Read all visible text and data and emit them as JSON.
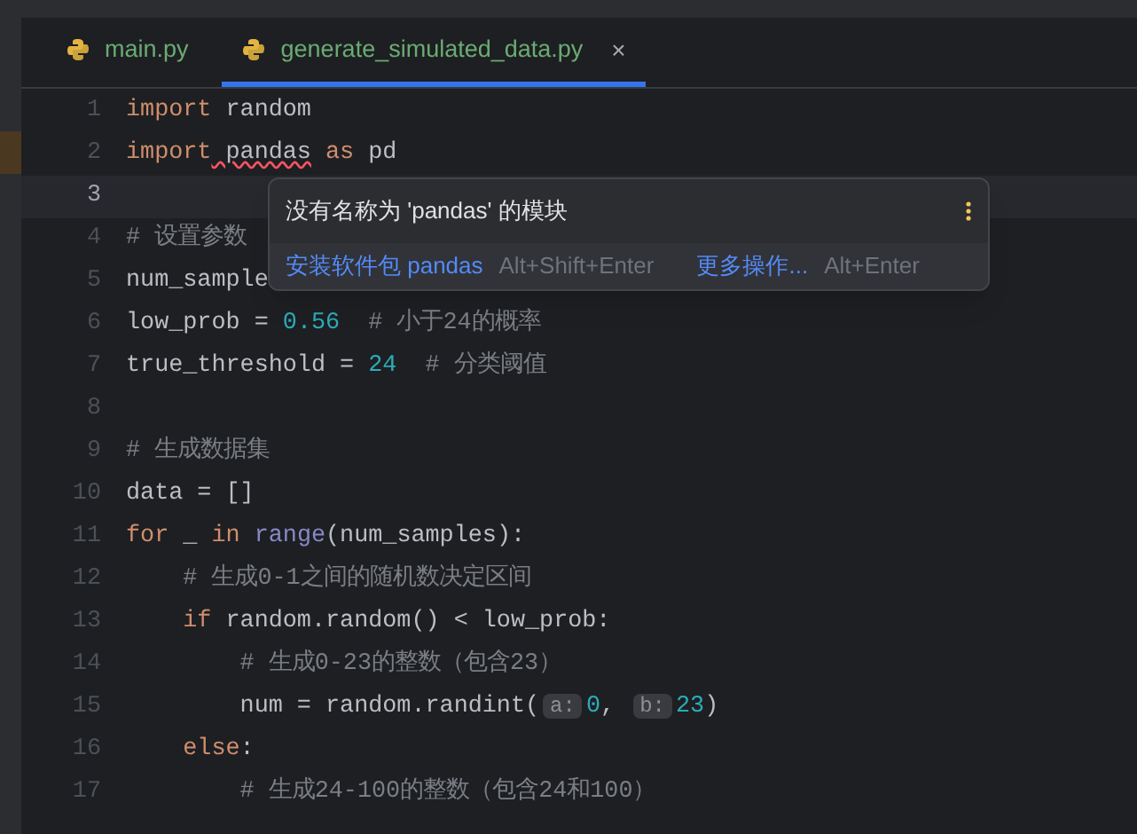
{
  "tabs": [
    {
      "label": "main.py",
      "selected": false
    },
    {
      "label": "generate_simulated_data.py",
      "selected": true,
      "close": "×"
    }
  ],
  "editor": {
    "lines": [
      {
        "number": "1",
        "current": false,
        "tokens": [
          {
            "kind": "keyword",
            "text": "import"
          },
          {
            "kind": "plain",
            "text": " random"
          }
        ]
      },
      {
        "number": "2",
        "current": false,
        "marked": true,
        "tokens": [
          {
            "kind": "keyword",
            "text": "import"
          },
          {
            "kind": "error",
            "text": " pandas"
          },
          {
            "kind": "keyword",
            "text": " as"
          },
          {
            "kind": "plain",
            "text": " pd"
          }
        ]
      },
      {
        "number": "3",
        "current": true
      },
      {
        "number": "4",
        "current": false,
        "tokens": [
          {
            "kind": "comment",
            "text": "# 设置参数"
          }
        ]
      },
      {
        "number": "5",
        "current": false,
        "tokens": [
          {
            "kind": "plain",
            "text": "num_sample"
          }
        ]
      },
      {
        "number": "6",
        "current": false,
        "tokens": [
          {
            "kind": "plain",
            "text": "low_prob = "
          },
          {
            "kind": "number",
            "text": "0.56"
          },
          {
            "kind": "comment",
            "text": "  # 小于24的概率"
          }
        ]
      },
      {
        "number": "7",
        "current": false,
        "tokens": [
          {
            "kind": "plain",
            "text": "true_threshold = "
          },
          {
            "kind": "number",
            "text": "24"
          },
          {
            "kind": "comment",
            "text": "  # 分类阈值"
          }
        ]
      },
      {
        "number": "8",
        "current": false
      },
      {
        "number": "9",
        "current": false,
        "tokens": [
          {
            "kind": "comment",
            "text": "# 生成数据集"
          }
        ]
      },
      {
        "number": "10",
        "current": false,
        "tokens": [
          {
            "kind": "plain",
            "text": "data = []"
          }
        ]
      },
      {
        "number": "11",
        "current": false,
        "tokens": [
          {
            "kind": "keyword",
            "text": "for"
          },
          {
            "kind": "plain",
            "text": " _"
          },
          {
            "kind": "keyword",
            "text": " in"
          },
          {
            "kind": "builtin",
            "text": " range"
          },
          {
            "kind": "plain",
            "text": "(num_samples):"
          }
        ]
      },
      {
        "number": "12",
        "current": false,
        "tokens": [
          {
            "kind": "comment",
            "text": "    # 生成0-1之间的随机数决定区间"
          }
        ]
      },
      {
        "number": "13",
        "current": false,
        "tokens": [
          {
            "kind": "keyword",
            "text": "    if"
          },
          {
            "kind": "plain",
            "text": " random.random() < low_prob:"
          }
        ]
      },
      {
        "number": "14",
        "current": false,
        "tokens": [
          {
            "kind": "comment",
            "text": "        # 生成0-23的整数（包含23）"
          }
        ]
      },
      {
        "number": "15",
        "current": false,
        "tokens": [
          {
            "kind": "plain",
            "text": "        num = random.randint("
          },
          {
            "kind": "hint",
            "text": "a:"
          },
          {
            "kind": "number",
            "text": "0"
          },
          {
            "kind": "plain",
            "text": ", "
          },
          {
            "kind": "hint",
            "text": "b:"
          },
          {
            "kind": "number",
            "text": "23"
          },
          {
            "kind": "plain",
            "text": ")"
          }
        ]
      },
      {
        "number": "16",
        "current": false,
        "tokens": [
          {
            "kind": "keyword",
            "text": "    else"
          },
          {
            "kind": "plain",
            "text": ":"
          }
        ]
      },
      {
        "number": "17",
        "current": false,
        "tokens": [
          {
            "kind": "comment",
            "text": "        # 生成24-100的整数（包含24和100）"
          }
        ]
      }
    ]
  },
  "popup": {
    "message": "没有名称为 'pandas' 的模块",
    "actions": [
      {
        "label": "安装软件包 pandas",
        "shortcut": "Alt+Shift+Enter"
      },
      {
        "label": "更多操作...",
        "shortcut": "Alt+Enter"
      }
    ]
  }
}
